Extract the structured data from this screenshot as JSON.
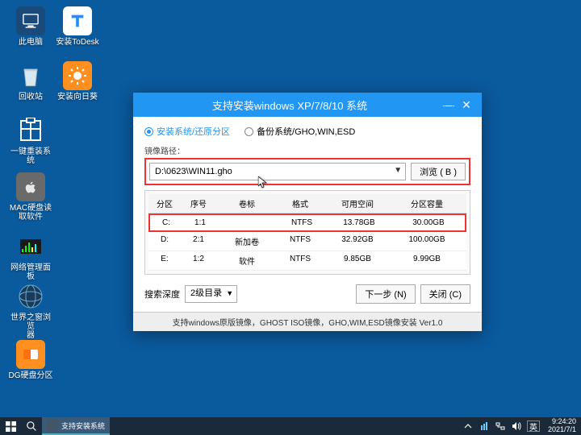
{
  "desktop": {
    "icons": [
      {
        "label": "此电脑"
      },
      {
        "label": "安装ToDesk"
      },
      {
        "label": "回收站"
      },
      {
        "label": "安装向日葵"
      },
      {
        "label": "一键重装系统"
      },
      {
        "label": "MAC硬盘读\n取软件"
      },
      {
        "label": "网络管理面板"
      },
      {
        "label": "世界之窗浏览\n器"
      },
      {
        "label": "DG硬盘分区"
      }
    ]
  },
  "dialog": {
    "title": "支持安装windows XP/7/8/10 系统",
    "radio_install": "安装系统/还原分区",
    "radio_backup": "备份系统/GHO,WIN,ESD",
    "image_path_label": "镜像路径：",
    "path_value": "D:\\0623\\WIN11.gho",
    "browse": "浏览 ( B )",
    "columns": [
      "分区",
      "序号",
      "卷标",
      "格式",
      "可用空间",
      "分区容量"
    ],
    "rows": [
      {
        "drive": "C:",
        "idx": "1:1",
        "vol": "",
        "fs": "NTFS",
        "free": "13.78GB",
        "size": "30.00GB",
        "selected": true
      },
      {
        "drive": "D:",
        "idx": "2:1",
        "vol": "新加卷",
        "fs": "NTFS",
        "free": "32.92GB",
        "size": "100.00GB",
        "selected": false
      },
      {
        "drive": "E:",
        "idx": "1:2",
        "vol": "软件",
        "fs": "NTFS",
        "free": "9.85GB",
        "size": "9.99GB",
        "selected": false
      }
    ],
    "search_depth_label": "搜索深度",
    "search_depth_value": "2级目录",
    "next_btn": "下一步 (N)",
    "close_btn": "关闭 (C)",
    "status": "支持windows原版镜像，GHOST ISO镜像，GHO,WIM,ESD镜像安装 Ver1.0"
  },
  "taskbar": {
    "active_label": "支持安装系统",
    "time": "9:24:20",
    "date": "2021/7/1"
  }
}
